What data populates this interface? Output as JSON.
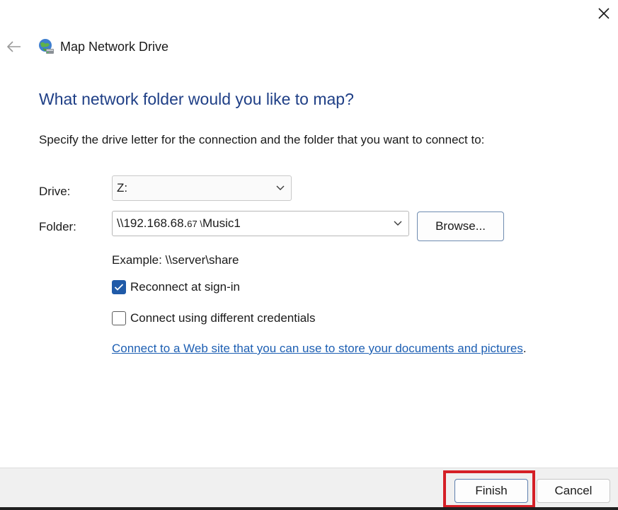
{
  "window": {
    "title": "Map Network Drive",
    "title_icon": "network-drive-icon",
    "close_icon": "close-icon",
    "back_icon": "back-arrow-icon"
  },
  "content": {
    "heading": "What network folder would you like to map?",
    "instruction": "Specify the drive letter for the connection and the folder that you want to connect to:",
    "drive": {
      "label": "Drive:",
      "value": "Z:"
    },
    "folder": {
      "label": "Folder:",
      "value_prefix": "\\\\192.168.68.",
      "value_small": "67 \\",
      "value_suffix": "Music1",
      "browse_label": "Browse..."
    },
    "example": "Example: \\\\server\\share",
    "reconnect": {
      "label": "Reconnect at sign-in",
      "checked": true
    },
    "credentials": {
      "label": "Connect using different credentials",
      "checked": false
    },
    "web_link": {
      "text": "Connect to a Web site that you can use to store your documents and pictures",
      "trailing": "."
    }
  },
  "footer": {
    "finish_label": "Finish",
    "cancel_label": "Cancel"
  },
  "colors": {
    "heading": "#1f3f86",
    "accent": "#1f5aa8",
    "link": "#1d5fb3",
    "highlight": "#d51f26"
  }
}
